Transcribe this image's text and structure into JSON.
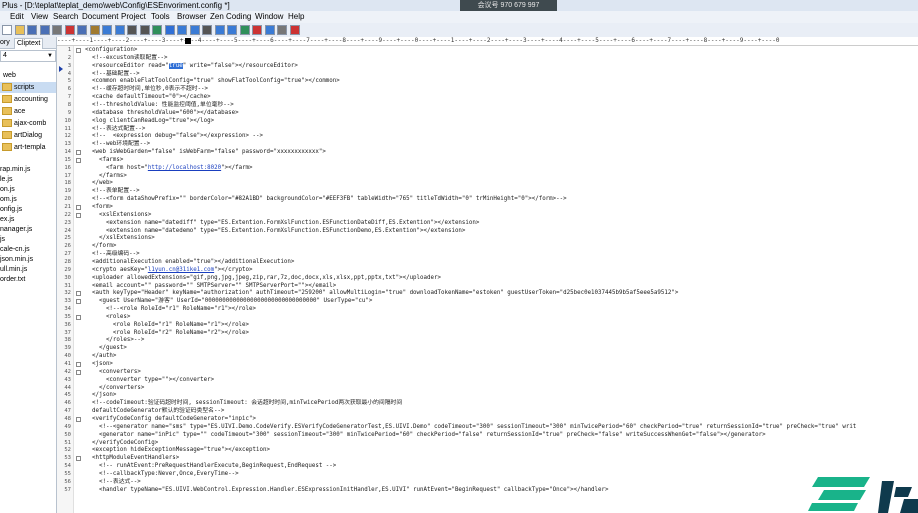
{
  "window": {
    "title": "Plus - [D:\\teplat\\teplat_demo\\web\\Config\\ESEnvoriment.config *]",
    "meeting_badge": "会议号 970 679 997"
  },
  "menu": [
    "Edit",
    "View",
    "Search",
    "Document",
    "Project",
    "Tools",
    "Browser",
    "Zen Coding",
    "Window",
    "Help"
  ],
  "left_panel": {
    "tabs": [
      "ory",
      "Cliptext"
    ],
    "drive": "4",
    "tree": [
      {
        "label": "web",
        "folder": false
      },
      {
        "label": "scripts",
        "folder": true,
        "selected": true
      },
      {
        "label": "accounting",
        "folder": true
      },
      {
        "label": "ace",
        "folder": true
      },
      {
        "label": "ajax-comb",
        "folder": true
      },
      {
        "label": "artDialog",
        "folder": true
      },
      {
        "label": "art-templa",
        "folder": true
      }
    ],
    "files": [
      "rap.min.js",
      "le.js",
      "on.js",
      "om.js",
      "onfig.js",
      "ex.js",
      "nanager.js",
      "js",
      "cale-cn.js",
      "json.min.js",
      "ull.min.js",
      "order.txt"
    ]
  },
  "ruler_text": "----+----1----+----2----+----3----+----4----+----5----+----6----+----7----+----8----+----9----+----0----+----1----+----2----+----3----+----4----+----5----+----6----+----7----+----8----+----9----+----0",
  "editor": {
    "lines": [
      {
        "n": "1",
        "fold": true,
        "text": "<configuration>"
      },
      {
        "n": "2",
        "fold": false,
        "text": "  <!--excustom读取配置-->"
      },
      {
        "n": "3",
        "fold": false,
        "pre": "  <resourceEditor read=\"",
        "hl": "true",
        "post": "\" write=\"false\"></resourceEditor>"
      },
      {
        "n": "4",
        "fold": false,
        "text": "  <!--基础配置-->"
      },
      {
        "n": "5",
        "fold": false,
        "text": "  <common enableFlatToolConfig=\"true\" showFlatToolConfig=\"true\"></common>"
      },
      {
        "n": "6",
        "fold": false,
        "text": "  <!--缓存超时时间,单位秒,0表示不超时-->"
      },
      {
        "n": "7",
        "fold": false,
        "text": "  <cache defaultTimeout=\"0\"></cache>"
      },
      {
        "n": "8",
        "fold": false,
        "text": "  <!--thresholdValue: 性能监控阈值,单位毫秒-->"
      },
      {
        "n": "9",
        "fold": false,
        "text": "  <database thresholdValue=\"600\"></database>"
      },
      {
        "n": "10",
        "fold": false,
        "text": "  <log clientCanReadLog=\"true\"></log>"
      },
      {
        "n": "11",
        "fold": false,
        "text": "  <!--表达式配置-->"
      },
      {
        "n": "12",
        "fold": false,
        "text": "  <!--  <expression debug=\"false\"></expression> -->"
      },
      {
        "n": "13",
        "fold": false,
        "text": "  <!--web环境配置-->"
      },
      {
        "n": "14",
        "fold": true,
        "text": "  <web isWebGarden=\"false\" isWebFarm=\"false\" password=\"xxxxxxxxxxxx\">"
      },
      {
        "n": "15",
        "fold": true,
        "text": "    <farms>"
      },
      {
        "n": "16",
        "fold": false,
        "pre": "      <farm host=\"",
        "link": "http://localhost:8020",
        "post": "\"></farm>"
      },
      {
        "n": "17",
        "fold": false,
        "text": "    </farms>"
      },
      {
        "n": "18",
        "fold": false,
        "text": "  </web>"
      },
      {
        "n": "19",
        "fold": false,
        "text": "  <!--表单配置-->"
      },
      {
        "n": "20",
        "fold": false,
        "text": "  <!--<form dataShowPrefix=\"\" borderColor=\"#82A1BD\" backgroundColor=\"#EEF3FB\" tableWidth=\"765\" titleTdWidth=\"0\" trMinHeight=\"0\"></form>-->"
      },
      {
        "n": "21",
        "fold": true,
        "text": "  <form>"
      },
      {
        "n": "22",
        "fold": true,
        "text": "    <xslExtensions>"
      },
      {
        "n": "23",
        "fold": false,
        "text": "      <extension name=\"datediff\" type=\"ES.Extention.FormXslFunction.ESFunctionDateDiff,ES.Extention\"></extension>"
      },
      {
        "n": "24",
        "fold": false,
        "text": "      <extension name=\"datedemo\" type=\"ES.Extention.FormXslFunction.ESFunctionDemo,ES.Extention\"></extension>"
      },
      {
        "n": "25",
        "fold": false,
        "text": "    </xslExtensions>"
      },
      {
        "n": "26",
        "fold": false,
        "text": "  </form>"
      },
      {
        "n": "27",
        "fold": false,
        "text": "  <!--高级编码-->"
      },
      {
        "n": "28",
        "fold": false,
        "text": "  <additionalExecution enabled=\"true\"></additionalExecution>"
      },
      {
        "n": "29",
        "fold": false,
        "pre": "  <crypto aesKey=\"",
        "link": "l1yun.cn@31ike1.com",
        "post": "\"></crypto>"
      },
      {
        "n": "30",
        "fold": false,
        "text": "  <uploader allowedExtensions=\"gif,png,jpg,jpeg,zip,rar,7z,doc,docx,xls,xlsx,ppt,pptx,txt\"></uploader>"
      },
      {
        "n": "31",
        "fold": false,
        "text": "  <email account=\"\" password=\"\" SMTPServer=\"\" SMTPServerPort=\"\"></email>"
      },
      {
        "n": "32",
        "fold": true,
        "text": "  <auth keyType=\"Header\" keyName=\"authorization\" authTimeout=\"259200\" allowMultiLogin=\"true\" downloadTokenName=\"estoken\" guestUserToken=\"d25bec0e1037445b9b5af5eee5a9512\">"
      },
      {
        "n": "33",
        "fold": true,
        "text": "    <guest UserName=\"游客\" UserId=\"00000000000000000000000000000000\" UserType=\"cu\">"
      },
      {
        "n": "34",
        "fold": false,
        "text": "      <!--<role RoleId=\"r1\" RoleName=\"r1\"></role>"
      },
      {
        "n": "35",
        "fold": true,
        "text": "      <roles>"
      },
      {
        "n": "36",
        "fold": false,
        "text": "        <role RoleId=\"r1\" RoleName=\"r1\"></role>"
      },
      {
        "n": "37",
        "fold": false,
        "text": "        <role RoleId=\"r2\" RoleName=\"r2\"></role>"
      },
      {
        "n": "38",
        "fold": false,
        "text": "      </roles>-->"
      },
      {
        "n": "39",
        "fold": false,
        "text": "    </guest>"
      },
      {
        "n": "40",
        "fold": false,
        "text": "  </auth>"
      },
      {
        "n": "41",
        "fold": true,
        "text": "  <json>"
      },
      {
        "n": "42",
        "fold": true,
        "text": "    <converters>"
      },
      {
        "n": "43",
        "fold": false,
        "text": "      <converter type=\"\"></converter>"
      },
      {
        "n": "44",
        "fold": false,
        "text": "    </converters>"
      },
      {
        "n": "45",
        "fold": false,
        "text": "  </json>"
      },
      {
        "n": "46",
        "fold": false,
        "text": "  <!--codeTimeout:验证码超时时间, sessionTimeout: 会话超时时间,minTwicePeriod两次获取最小的间隔时间"
      },
      {
        "n": "47",
        "fold": false,
        "text": "  defaultCodeGenerator默认的验证码类型名-->"
      },
      {
        "n": "48",
        "fold": true,
        "text": "  <verifyCodeConfig defaultCodeGenerator=\"inpic\">"
      },
      {
        "n": "49",
        "fold": false,
        "text": "    <!--<generator name=\"sms\" type=\"ES.UIVI.Demo.CodeVerify.ESVerifyCodeGeneratorTest,ES.UIVI.Demo\" codeTimeout=\"300\" sessionTimeout=\"300\" minTwicePeriod=\"60\" checkPeriod=\"true\" returnSessionId=\"true\" preCheck=\"true\" writ"
      },
      {
        "n": "50",
        "fold": false,
        "text": "    <generator name=\"inPic\" type=\"\" codeTimeout=\"300\" sessionTimeout=\"300\" minTwicePeriod=\"60\" checkPeriod=\"false\" returnSessionId=\"true\" preCheck=\"false\" writeSuccessWhenGet=\"false\"></generator>"
      },
      {
        "n": "51",
        "fold": false,
        "text": "  </verifyCodeConfig>"
      },
      {
        "n": "52",
        "fold": false,
        "text": "  <exception hideExceptionMessage=\"true\"></exception>"
      },
      {
        "n": "53",
        "fold": true,
        "text": "  <httpModuleEventHandlers>"
      },
      {
        "n": "54",
        "fold": false,
        "text": "    <!-- runAtEvent:PreRequestHandlerExecute,BeginRequest,EndRequest -->"
      },
      {
        "n": "55",
        "fold": false,
        "text": "    <!--callbackType:Never,Once,EveryTime-->"
      },
      {
        "n": "56",
        "fold": false,
        "text": "    <!--表达式-->"
      },
      {
        "n": "57",
        "fold": false,
        "text": "    <handler typeName=\"ES.UIVI.WebControl.Expression.Handler.ESExpressionInitHandler,ES.UIVI\" runAtEvent=\"BeginRequest\" callbackType=\"Once\"></handler>"
      }
    ]
  },
  "colors": {
    "accent_green": "#19b38a",
    "logo_dark": "#0f3a4d",
    "selection": "#2f6fd6"
  }
}
